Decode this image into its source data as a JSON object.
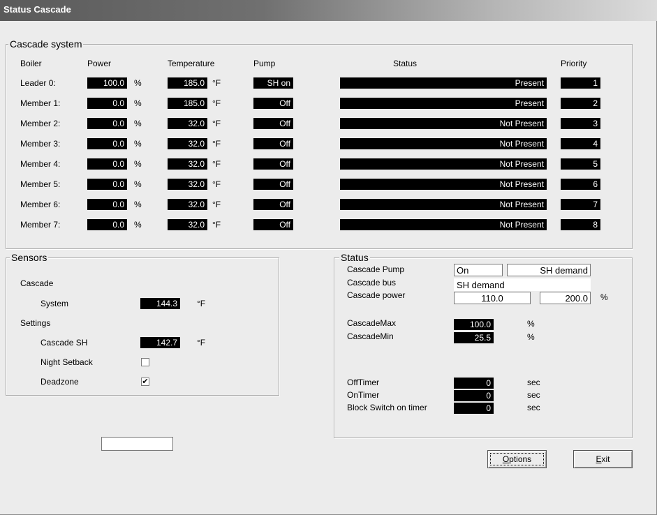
{
  "window": {
    "title": "Status Cascade"
  },
  "cascade": {
    "legend": "Cascade system",
    "headers": {
      "boiler": "Boiler",
      "power": "Power",
      "temperature": "Temperature",
      "pump": "Pump",
      "status": "Status",
      "priority": "Priority"
    },
    "units": {
      "power": "%",
      "temperature": "°F"
    },
    "rows": [
      {
        "name": "Leader 0:",
        "power": "100.0",
        "temp": "185.0",
        "pump": "SH on",
        "status": "Present",
        "priority": "1"
      },
      {
        "name": "Member 1:",
        "power": "0.0",
        "temp": "185.0",
        "pump": "Off",
        "status": "Present",
        "priority": "2"
      },
      {
        "name": "Member 2:",
        "power": "0.0",
        "temp": "32.0",
        "pump": "Off",
        "status": "Not Present",
        "priority": "3"
      },
      {
        "name": "Member 3:",
        "power": "0.0",
        "temp": "32.0",
        "pump": "Off",
        "status": "Not Present",
        "priority": "4"
      },
      {
        "name": "Member 4:",
        "power": "0.0",
        "temp": "32.0",
        "pump": "Off",
        "status": "Not Present",
        "priority": "5"
      },
      {
        "name": "Member 5:",
        "power": "0.0",
        "temp": "32.0",
        "pump": "Off",
        "status": "Not Present",
        "priority": "6"
      },
      {
        "name": "Member 6:",
        "power": "0.0",
        "temp": "32.0",
        "pump": "Off",
        "status": "Not Present",
        "priority": "7"
      },
      {
        "name": "Member 7:",
        "power": "0.0",
        "temp": "32.0",
        "pump": "Off",
        "status": "Not Present",
        "priority": "8"
      }
    ]
  },
  "sensors": {
    "legend": "Sensors",
    "cascade_label": "Cascade",
    "system_label": "System",
    "system_value": "144.3",
    "temp_unit": "°F",
    "settings_label": "Settings",
    "cascade_sh_label": "Cascade SH",
    "cascade_sh_value": "142.7",
    "night_setback_label": "Night Setback",
    "night_setback_checked": false,
    "deadzone_label": "Deadzone",
    "deadzone_checked": true,
    "checkmark": "✔"
  },
  "status": {
    "legend": "Status",
    "cascade_pump_label": "Cascade Pump",
    "cascade_pump_value": "On",
    "cascade_pump_mode": "SH demand",
    "cascade_bus_label": "Cascade bus",
    "cascade_bus_value": "SH demand",
    "cascade_power_label": "Cascade power",
    "cascade_power_value": "110.0",
    "cascade_power_max": "200.0",
    "percent": "%",
    "cascade_max_label": "CascadeMax",
    "cascade_max_value": "100.0",
    "cascade_min_label": "CascadeMin",
    "cascade_min_value": "25.5",
    "off_timer_label": "OffTimer",
    "off_timer_value": "0",
    "on_timer_label": "OnTimer",
    "on_timer_value": "0",
    "block_switch_label": "Block Switch on timer",
    "block_switch_value": "0",
    "sec": "sec"
  },
  "bottom_input": {
    "value": ""
  },
  "buttons": {
    "options_mnemonic": "O",
    "options_rest": "ptions",
    "exit_mnemonic": "E",
    "exit_rest": "xit"
  }
}
